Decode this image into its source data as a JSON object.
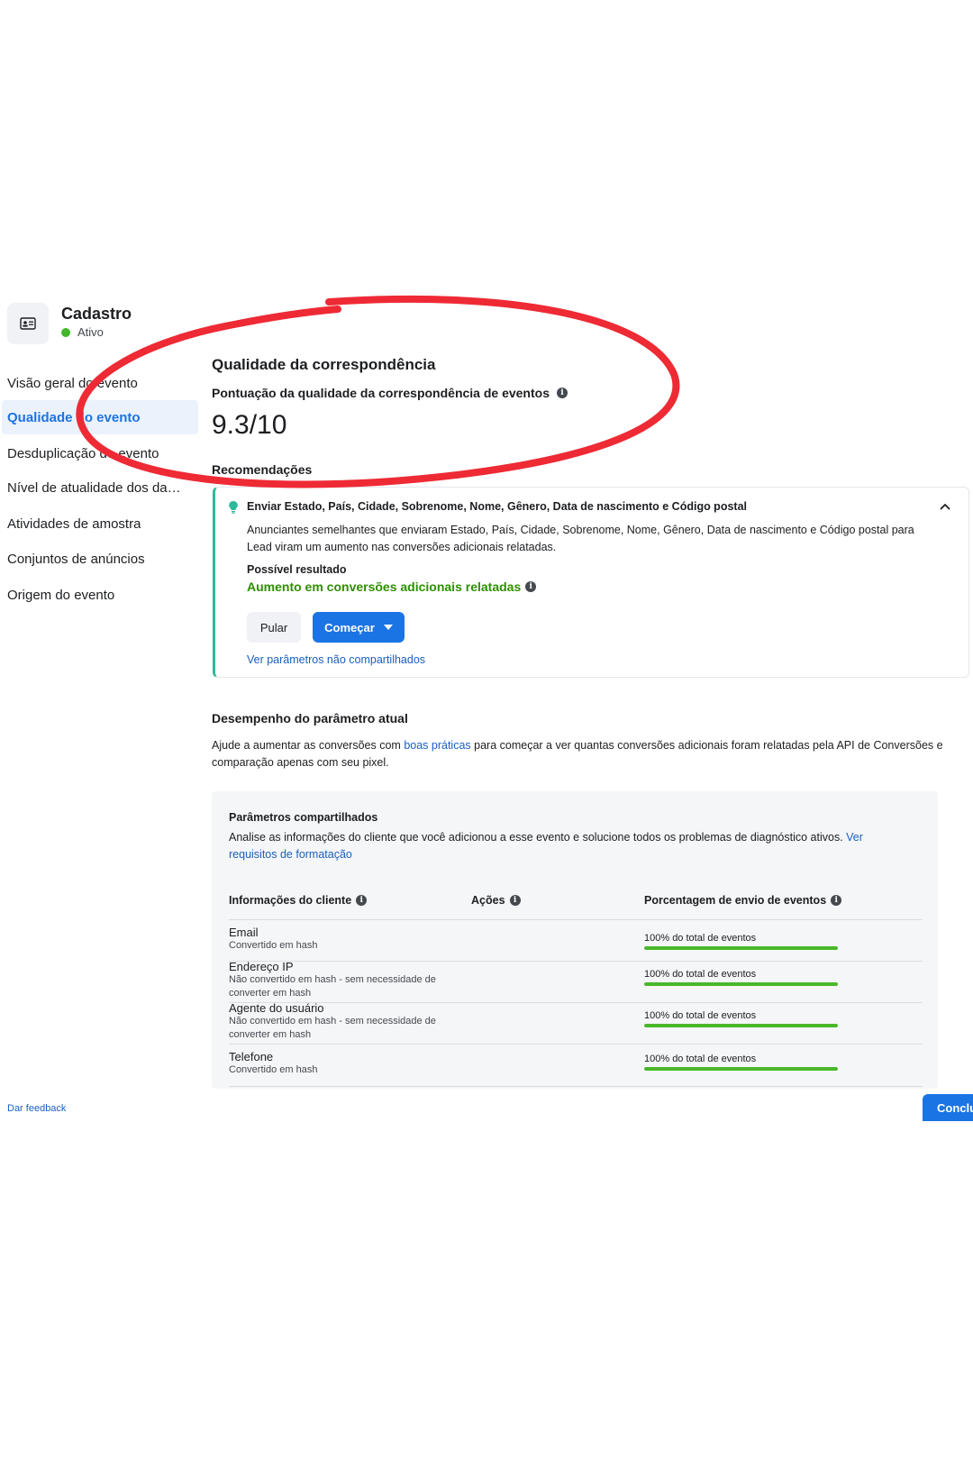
{
  "event": {
    "title": "Cadastro",
    "status": "Ativo",
    "icon": "id-card-icon"
  },
  "sidebar": {
    "items": [
      {
        "label": "Visão geral do evento",
        "active": false
      },
      {
        "label": "Qualidade do evento",
        "active": true
      },
      {
        "label": "Desduplicação do evento",
        "active": false
      },
      {
        "label": "Nível de atualidade dos dados",
        "active": false
      },
      {
        "label": "Atividades de amostra",
        "active": false
      },
      {
        "label": "Conjuntos de anúncios",
        "active": false
      },
      {
        "label": "Origem do evento",
        "active": false
      }
    ]
  },
  "quality": {
    "heading": "Qualidade da correspondência",
    "score_label": "Pontuação da qualidade da correspondência de eventos",
    "score": "9.3/10"
  },
  "recommendations": {
    "heading": "Recomendações",
    "card": {
      "title": "Enviar Estado, País, Cidade, Sobrenome, Nome, Gênero, Data de nascimento e Código postal",
      "description": "Anunciantes semelhantes que enviaram Estado, País, Cidade, Sobrenome, Nome, Gênero, Data de nascimento e Código postal para Lead viram um aumento nas conversões adicionais relatadas.",
      "result_label": "Possível resultado",
      "result": "Aumento em conversões adicionais relatadas",
      "skip_label": "Pular",
      "start_label": "Começar",
      "link": "Ver parâmetros não compartilhados"
    }
  },
  "performance": {
    "heading": "Desempenho do parâmetro atual",
    "desc_before": "Ajude a aumentar as conversões com ",
    "desc_link": "boas práticas",
    "desc_after": " para começar a ver quantas conversões adicionais foram relatadas pela API de Conversões e",
    "desc_line2": "comparação apenas com seu pixel."
  },
  "shared_params": {
    "title": "Parâmetros compartilhados",
    "desc": "Analise as informações do cliente que você adicionou a esse evento e solucione todos os problemas de diagnóstico ativos. ",
    "desc_link": "Ver requisitos de formatação",
    "columns": [
      "Informações do cliente",
      "Ações",
      "Porcentagem de envio de eventos"
    ],
    "rows": [
      {
        "name": "Email",
        "sub": "Convertido em hash",
        "pct_text": "100% do total de eventos",
        "pct": 100
      },
      {
        "name": "Endereço IP",
        "sub": "Não convertido em hash - sem necessidade de converter em hash",
        "pct_text": "100% do total de eventos",
        "pct": 100
      },
      {
        "name": "Agente do usuário",
        "sub": "Não convertido em hash - sem necessidade de converter em hash",
        "pct_text": "100% do total de eventos",
        "pct": 100
      },
      {
        "name": "Telefone",
        "sub": "Convertido em hash",
        "pct_text": "100% do total de eventos",
        "pct": 100
      }
    ]
  },
  "footer": {
    "feedback": "Dar feedback",
    "done": "Concluir"
  },
  "colors": {
    "accent": "#1b74e4",
    "success": "#2f8f00",
    "bar": "#48b82a",
    "annotation": "#ee2a35"
  }
}
